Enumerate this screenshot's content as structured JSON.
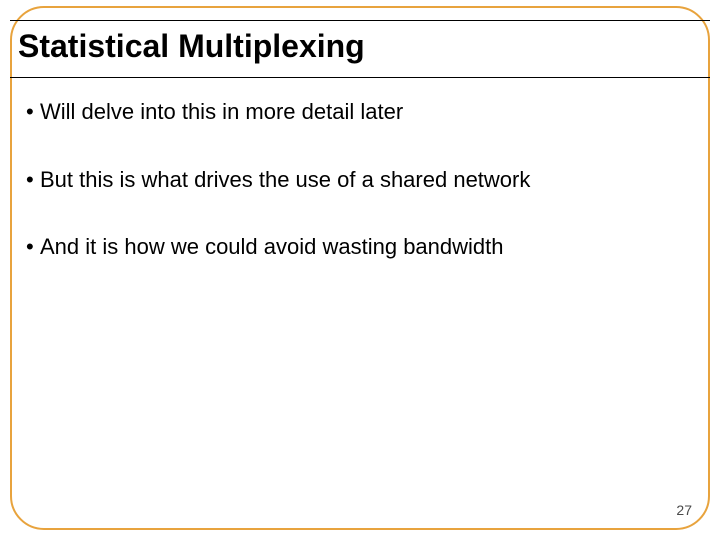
{
  "slide": {
    "title": "Statistical Multiplexing",
    "bullets": [
      "Will delve into this in more detail later",
      "But this is what drives the use of a shared network",
      "And it is how we could avoid wasting bandwidth"
    ],
    "page_number": "27"
  }
}
